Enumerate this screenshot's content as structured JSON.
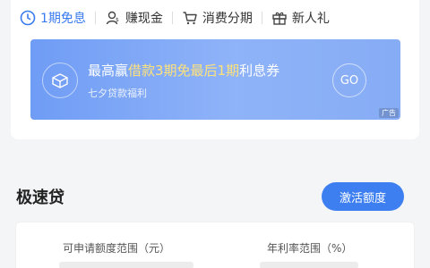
{
  "tabs": [
    {
      "label": "1期免息",
      "icon": "clock-icon",
      "active": true
    },
    {
      "label": "赚现金",
      "icon": "person-icon"
    },
    {
      "label": "消费分期",
      "icon": "cart-icon"
    },
    {
      "label": "新人礼",
      "icon": "gift-icon"
    }
  ],
  "banner": {
    "title_prefix": "最高赢",
    "title_highlight": "借款3期免最后1期",
    "title_suffix": "利息券",
    "subtitle": "七夕贷款福利",
    "go_label": "GO",
    "ad_label": "广告"
  },
  "section": {
    "title": "极速贷",
    "activate_label": "激活额度"
  },
  "ranges": {
    "amount_label": "可申请额度范围（元）",
    "rate_label": "年利率范围（%）"
  },
  "colors": {
    "accent": "#3a7bf0",
    "highlight": "#ffe27a"
  }
}
